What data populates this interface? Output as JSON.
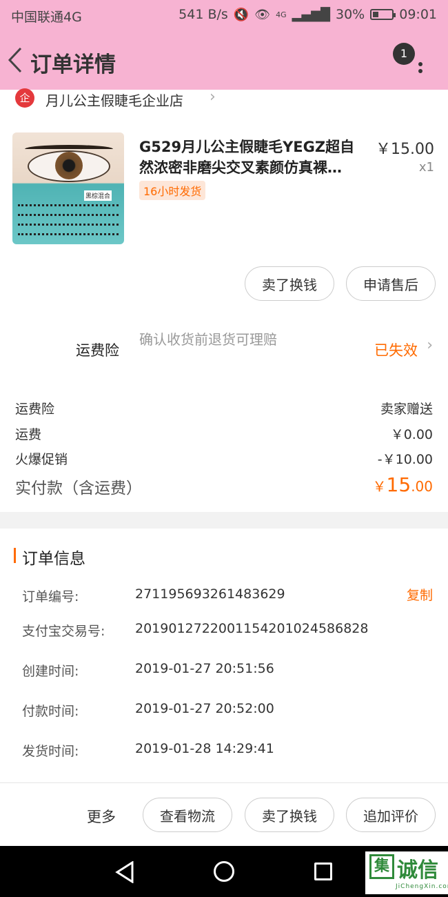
{
  "status_bar": {
    "carrier": "中国联通4G",
    "net_speed": "541 B/s",
    "network": "4G",
    "battery": "30%",
    "time": "09:01"
  },
  "header": {
    "title": "订单详情",
    "badge_count": "1"
  },
  "shop": {
    "badge": "企",
    "name": "月儿公主假睫毛企业店"
  },
  "product": {
    "name": "G529月儿公主假睫毛YEGZ超自然浓密非磨尖交叉素颜仿真裸…",
    "tag": "16小时发货",
    "price": "￥15.00",
    "qty": "x1",
    "thumb_label": "黑棕混合"
  },
  "item_actions": {
    "sell": "卖了换钱",
    "after_sale": "申请售后"
  },
  "freight_insurance": {
    "label": "运费险",
    "desc": "确认收货前退货可理赔",
    "status": "已失效"
  },
  "costs": [
    {
      "label": "运费险",
      "value": "卖家赠送"
    },
    {
      "label": "运费",
      "value": "￥0.00"
    },
    {
      "label": "火爆促销",
      "value": "-￥10.00"
    }
  ],
  "payment": {
    "label": "实付款（含运费）",
    "currency": "￥",
    "integer": "15",
    "decimal": ".00"
  },
  "order_info": {
    "title": "订单信息",
    "copy": "复制",
    "rows": [
      {
        "key": "订单编号:",
        "value": "271195693261483629"
      },
      {
        "key": "支付宝交易号:",
        "value": "2019012722001154201024586828"
      },
      {
        "key": "创建时间:",
        "value": "2019-01-27 20:51:56"
      },
      {
        "key": "付款时间:",
        "value": "2019-01-27 20:52:00"
      },
      {
        "key": "发货时间:",
        "value": "2019-01-28 14:29:41"
      }
    ]
  },
  "bottom_bar": {
    "more": "更多",
    "logistics": "查看物流",
    "sell": "卖了换钱",
    "review": "追加评价"
  },
  "watermark": {
    "box": "集",
    "text": "诚信",
    "url": "JiChengXin.com"
  }
}
